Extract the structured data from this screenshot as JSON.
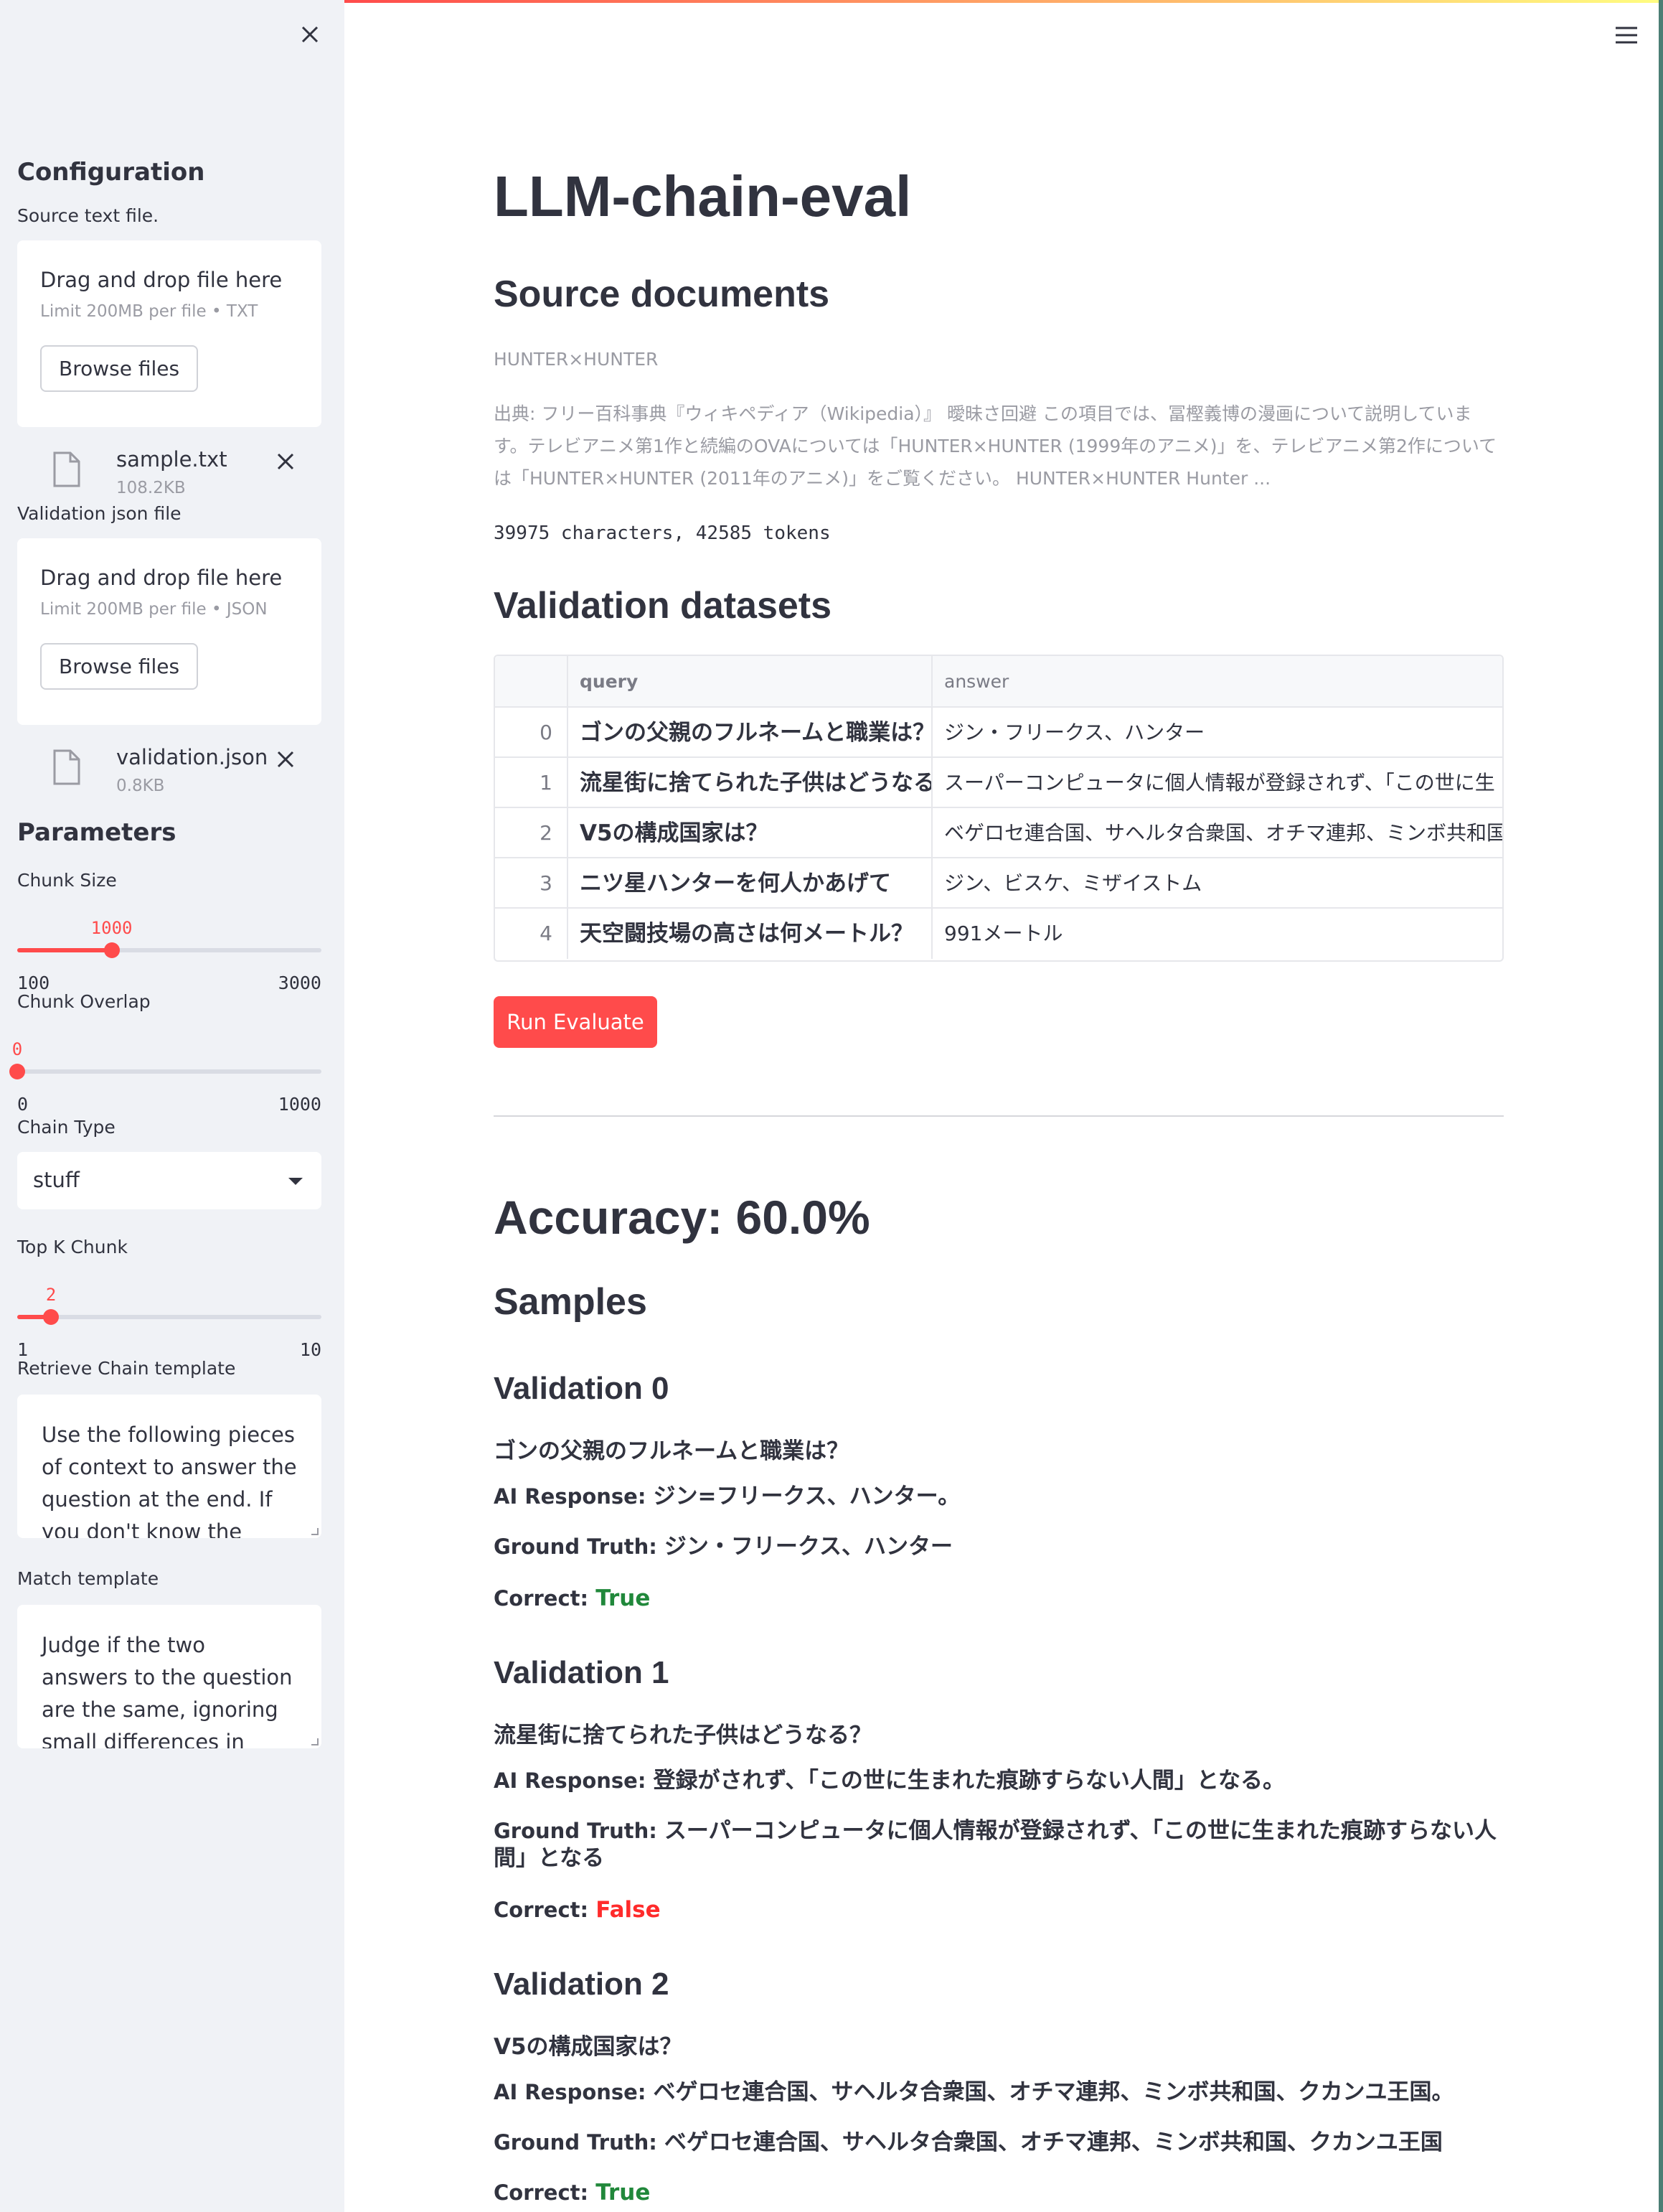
{
  "sidebar": {
    "close_icon": "close-icon",
    "config_heading": "Configuration",
    "source_label": "Source text file.",
    "source_uploader": {
      "title": "Drag and drop file here",
      "limit": "Limit 200MB per file • TXT",
      "browse": "Browse files"
    },
    "source_file": {
      "name": "sample.txt",
      "size": "108.2KB"
    },
    "validation_label": "Validation json file",
    "validation_uploader": {
      "title": "Drag and drop file here",
      "limit": "Limit 200MB per file • JSON",
      "browse": "Browse files"
    },
    "validation_file": {
      "name": "validation.json",
      "size": "0.8KB"
    },
    "params_heading": "Parameters",
    "chunk_size": {
      "label": "Chunk Size",
      "value": "1000",
      "min": "100",
      "max": "3000"
    },
    "chunk_overlap": {
      "label": "Chunk Overlap",
      "value": "0",
      "min": "0",
      "max": "1000"
    },
    "chain_type": {
      "label": "Chain Type",
      "value": "stuff"
    },
    "top_k": {
      "label": "Top K Chunk",
      "value": "2",
      "min": "1",
      "max": "10"
    },
    "retrieve_template": {
      "label": "Retrieve Chain template",
      "text": "Use the following pieces of context to answer the question at the end. If you don't know the"
    },
    "match_template": {
      "label": "Match template",
      "text": "Judge if the two answers to the question are the same, ignoring small differences in expression."
    }
  },
  "main": {
    "title": "LLM-chain-eval",
    "source_heading": "Source documents",
    "doc_title": "HUNTER×HUNTER",
    "doc_excerpt": "出典: フリー百科事典『ウィキペディア（Wikipedia）』 曖昧さ回避 この項目では、冨樫義博の漫画について説明しています。テレビアニメ第1作と続編のOVAについては「HUNTER×HUNTER (1999年のアニメ)」を、テレビアニメ第2作については「HUNTER×HUNTER (2011年のアニメ)」をご覧ください。 HUNTER×HUNTER Hunter ...",
    "doc_stats": "39975 characters, 42585 tokens",
    "validation_heading": "Validation datasets",
    "table": {
      "columns": [
        "query",
        "answer"
      ],
      "rows": [
        {
          "idx": "0",
          "query": "ゴンの父親のフルネームと職業は？",
          "answer": "ジン・フリークス、ハンター"
        },
        {
          "idx": "1",
          "query": "流星街に捨てられた子供はどうなる？",
          "answer": "スーパーコンピュータに個人情報が登録されず、「この世に生"
        },
        {
          "idx": "2",
          "query": "V5の構成国家は？",
          "answer": "ベゲロセ連合国、サヘルタ合衆国、オチマ連邦、ミンボ共和国"
        },
        {
          "idx": "3",
          "query": "ニツ星ハンターを何人かあげて",
          "answer": "ジン、ビスケ、ミザイストム"
        },
        {
          "idx": "4",
          "query": "天空闘技場の高さは何メートル？",
          "answer": "991メートル"
        }
      ]
    },
    "run_button": "Run Evaluate",
    "accuracy": "Accuracy: 60.0%",
    "samples_heading": "Samples",
    "labels": {
      "ai": "AI Response: ",
      "gt": "Ground Truth: ",
      "correct": "Correct: "
    },
    "samples": [
      {
        "heading": "Validation 0",
        "question": "ゴンの父親のフルネームと職業は？",
        "ai": "ジン=フリークス、ハンター。",
        "gt": "ジン・フリークス、ハンター",
        "correct": "True"
      },
      {
        "heading": "Validation 1",
        "question": "流星街に捨てられた子供はどうなる？",
        "ai": "登録がされず、「この世に生まれた痕跡すらない人間」となる。",
        "gt": "スーパーコンピュータに個人情報が登録されず、「この世に生まれた痕跡すらない人間」となる",
        "correct": "False"
      },
      {
        "heading": "Validation 2",
        "question": "V5の構成国家は？",
        "ai": "ベゲロセ連合国、サヘルタ合衆国、オチマ連邦、ミンボ共和国、クカンユ王国。",
        "gt": "ベゲロセ連合国、サヘルタ合衆国、オチマ連邦、ミンボ共和国、クカンユ王国",
        "correct": "True"
      }
    ]
  },
  "colors": {
    "accent": "#ff4b4b",
    "true": "#21883b",
    "false": "#ff2b2b",
    "sidebar_bg": "#f0f2f6"
  },
  "slider_fractions": {
    "chunk_size": 0.3103,
    "chunk_overlap": 0.0,
    "top_k": 0.1111
  }
}
